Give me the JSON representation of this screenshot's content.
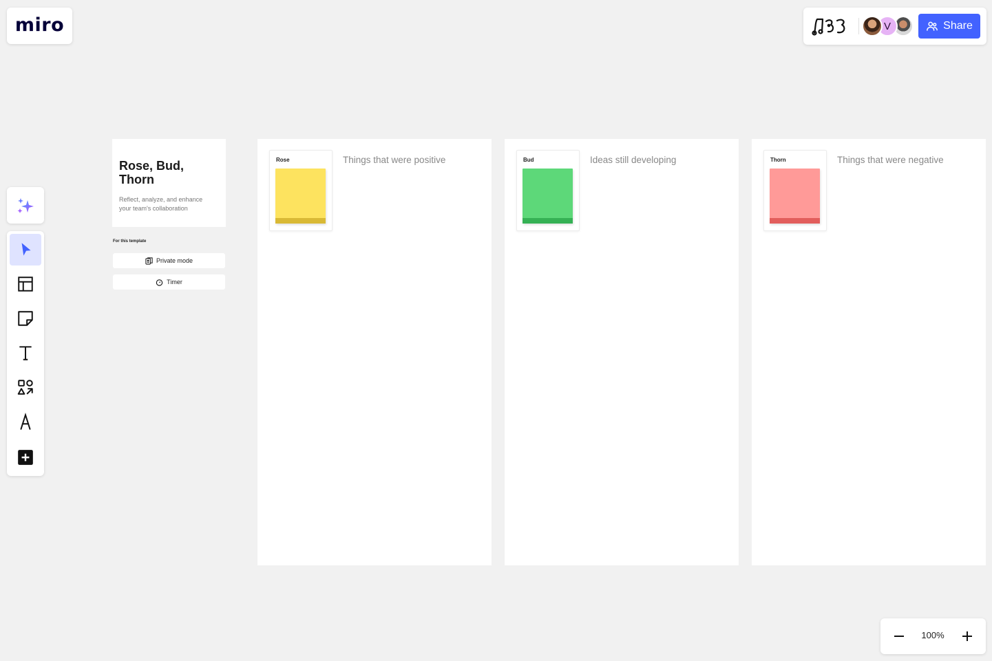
{
  "app": {
    "logo": "miro"
  },
  "header": {
    "share_label": "Share",
    "avatars": [
      {
        "initial": ""
      },
      {
        "initial": "V"
      },
      {
        "initial": ""
      }
    ]
  },
  "toolbar": {
    "tools": [
      {
        "name": "ai-sparkle",
        "icon": "sparkles-icon"
      },
      {
        "name": "select",
        "icon": "cursor-icon",
        "active": true
      },
      {
        "name": "templates",
        "icon": "layout-icon"
      },
      {
        "name": "sticky-note",
        "icon": "sticky-note-icon"
      },
      {
        "name": "text",
        "icon": "text-icon"
      },
      {
        "name": "shapes",
        "icon": "shapes-icon"
      },
      {
        "name": "pen",
        "icon": "pen-icon"
      },
      {
        "name": "more",
        "icon": "plus-square-icon"
      }
    ]
  },
  "template": {
    "title": "Rose, Bud, Thorn",
    "description": "Reflect, analyze, and enhance your team's collaboration",
    "for_label": "For this template",
    "buttons": [
      {
        "label": "Private mode",
        "icon": "private-mode-icon"
      },
      {
        "label": "Timer",
        "icon": "timer-icon"
      }
    ]
  },
  "columns": [
    {
      "label": "Rose",
      "description": "Things that were positive",
      "color": "#fde35f",
      "fold_color": "#d9b935"
    },
    {
      "label": "Bud",
      "description": "Ideas still developing",
      "color": "#5dd879",
      "fold_color": "#35b154"
    },
    {
      "label": "Thorn",
      "description": "Things that were negative",
      "color": "#ff9a98",
      "fold_color": "#e25e5c"
    }
  ],
  "zoom": {
    "level": "100%"
  },
  "colors": {
    "accent": "#4262ff",
    "canvas": "#f1f1f1"
  }
}
